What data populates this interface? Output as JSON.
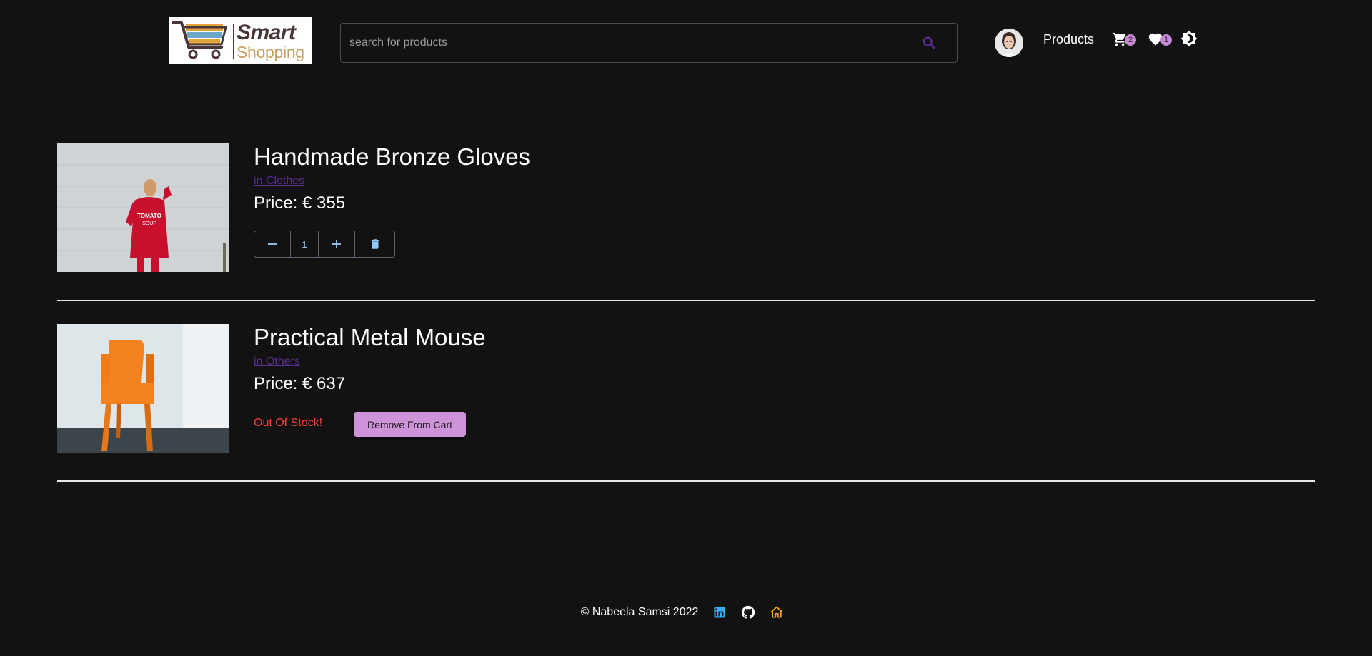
{
  "header": {
    "logo": {
      "line1": "Smart",
      "line2": "Shopping"
    },
    "search": {
      "placeholder": "search for products",
      "value": "",
      "icon": "search-icon"
    },
    "nav": {
      "products_label": "Products"
    },
    "cart": {
      "icon": "cart-icon",
      "count": "2"
    },
    "wishlist": {
      "icon": "heart-icon",
      "count": "1"
    },
    "theme_toggle": {
      "icon": "brightness-icon"
    }
  },
  "cart_items": [
    {
      "title": "Handmade Bronze Gloves",
      "category": "in Clothes",
      "price": "Price: € 355",
      "quantity": "1",
      "in_stock": true,
      "image": "woman-red-sweater-photo"
    },
    {
      "title": "Practical Metal Mouse",
      "category": "in Others",
      "price": "Price: € 637",
      "in_stock": false,
      "stock_message": "Out Of Stock!",
      "remove_label": "Remove From Cart",
      "image": "orange-chair-photo"
    }
  ],
  "footer": {
    "copyright": "© Nabeela Samsi 2022",
    "icons": [
      "linkedin-icon",
      "github-icon",
      "home-icon"
    ]
  },
  "colors": {
    "background": "#121212",
    "category_link": "#5b2d8e",
    "badge": "#c48bd3",
    "qty_controls": "#90caf9",
    "out_of_stock": "#f44336",
    "remove_button": "#ce93d8",
    "linkedin": "#29b6f6",
    "home": "#ffa726"
  }
}
